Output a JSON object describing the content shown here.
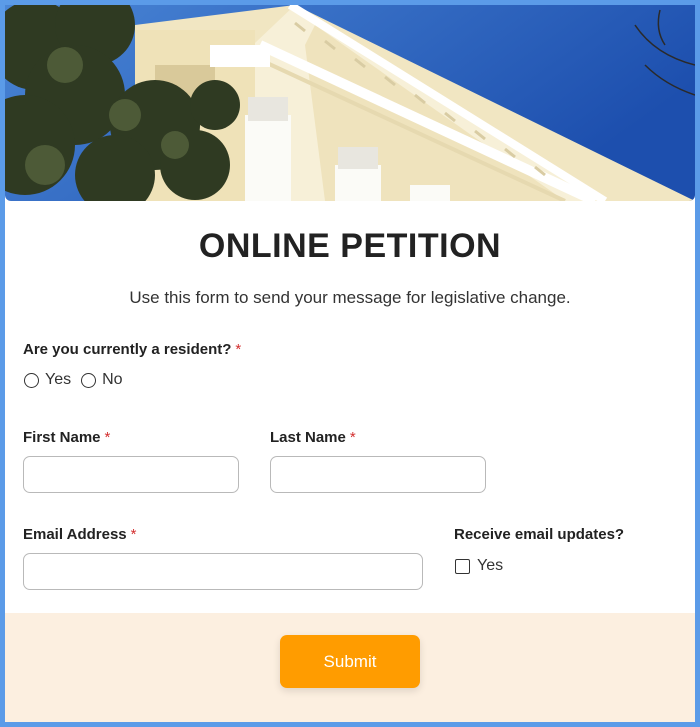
{
  "header": {
    "title": "ONLINE PETITION",
    "subtitle": "Use this form to send your message for legislative change.",
    "banner_image": "neoclassical-building-columns-photo"
  },
  "resident_question": {
    "label": "Are you currently a resident?",
    "required_mark": "*",
    "options": [
      "Yes",
      "No"
    ]
  },
  "first_name": {
    "label": "First Name",
    "required_mark": "*",
    "value": ""
  },
  "last_name": {
    "label": "Last Name",
    "required_mark": "*",
    "value": ""
  },
  "email": {
    "label": "Email Address",
    "required_mark": "*",
    "value": ""
  },
  "updates": {
    "label": "Receive email updates?",
    "option": "Yes"
  },
  "submit": {
    "label": "Submit"
  },
  "colors": {
    "page_border": "#5b9be8",
    "required": "#d32f2f",
    "submit_bg": "#ff9c00",
    "footer_bg": "#fcefe0"
  }
}
